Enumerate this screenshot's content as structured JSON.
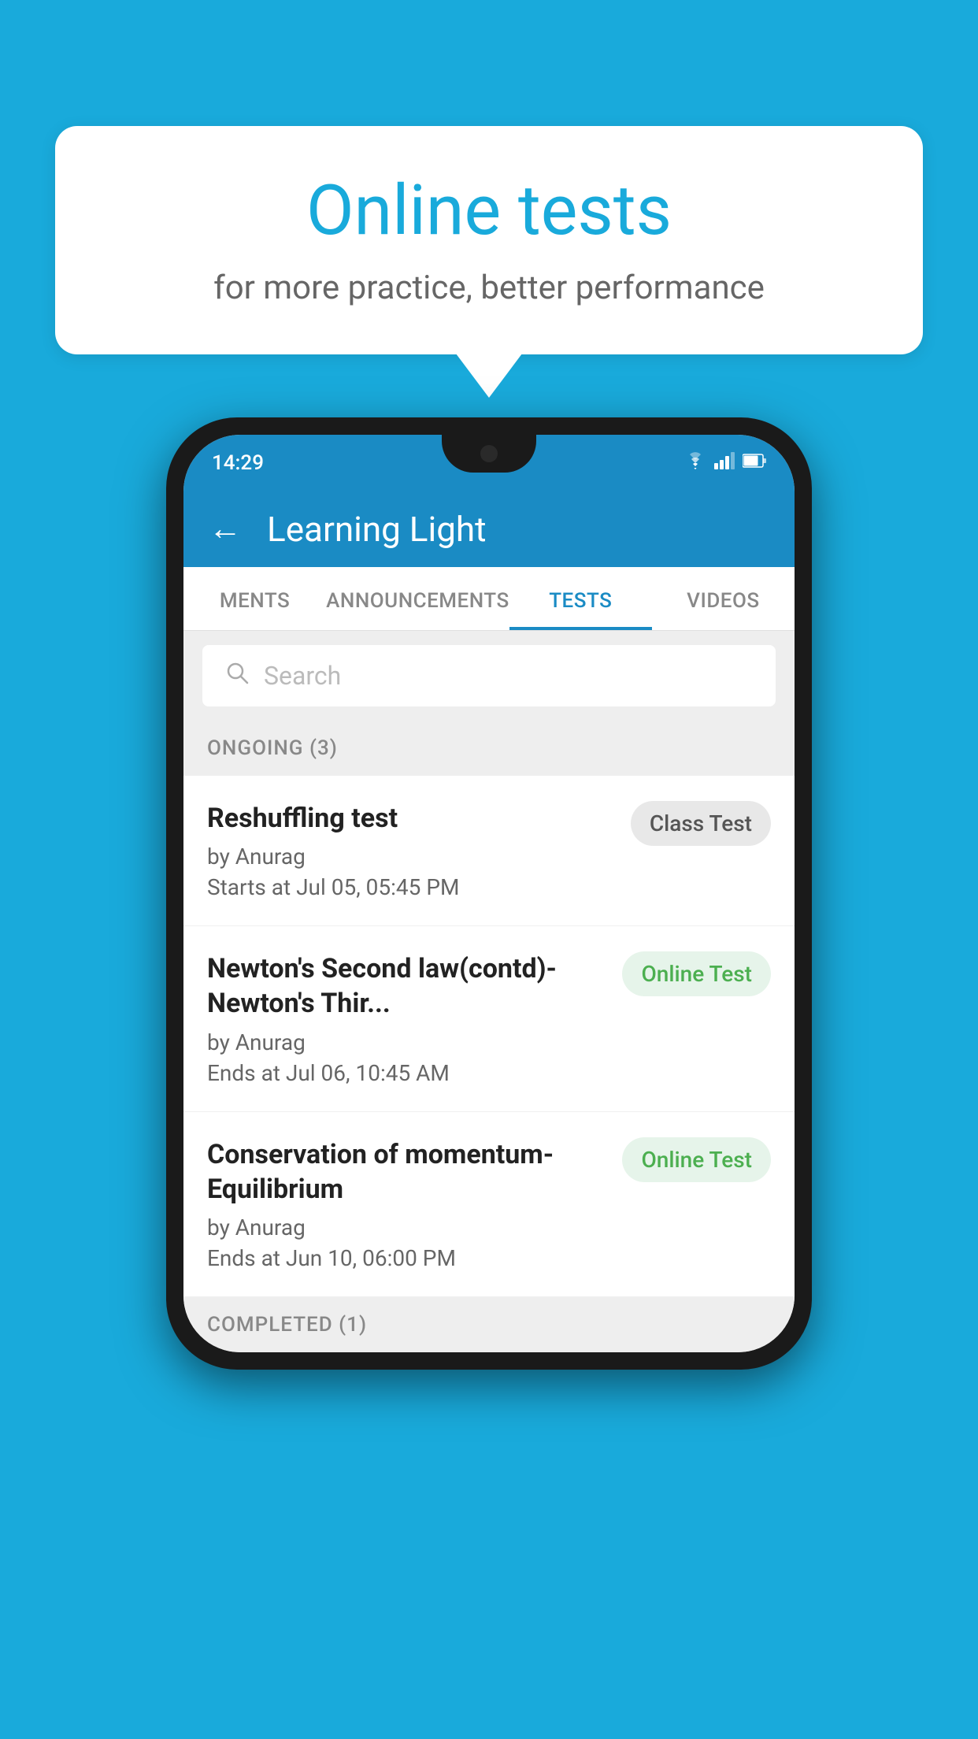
{
  "background_color": "#19AADB",
  "speech_bubble": {
    "title": "Online tests",
    "subtitle": "for more practice, better performance"
  },
  "phone": {
    "status_bar": {
      "time": "14:29",
      "icons": [
        "wifi",
        "signal",
        "battery"
      ]
    },
    "app_bar": {
      "title": "Learning Light",
      "back_label": "←"
    },
    "tabs": [
      {
        "label": "MENTS",
        "active": false
      },
      {
        "label": "ANNOUNCEMENTS",
        "active": false
      },
      {
        "label": "TESTS",
        "active": true
      },
      {
        "label": "VIDEOS",
        "active": false
      }
    ],
    "search": {
      "placeholder": "Search"
    },
    "ongoing_section": {
      "label": "ONGOING (3)"
    },
    "tests": [
      {
        "name": "Reshuffling test",
        "by": "by Anurag",
        "time": "Starts at  Jul 05, 05:45 PM",
        "badge": "Class Test",
        "badge_type": "class"
      },
      {
        "name": "Newton's Second law(contd)-Newton's Thir...",
        "by": "by Anurag",
        "time": "Ends at  Jul 06, 10:45 AM",
        "badge": "Online Test",
        "badge_type": "online"
      },
      {
        "name": "Conservation of momentum-Equilibrium",
        "by": "by Anurag",
        "time": "Ends at  Jun 10, 06:00 PM",
        "badge": "Online Test",
        "badge_type": "online"
      }
    ],
    "completed_section": {
      "label": "COMPLETED (1)"
    }
  }
}
